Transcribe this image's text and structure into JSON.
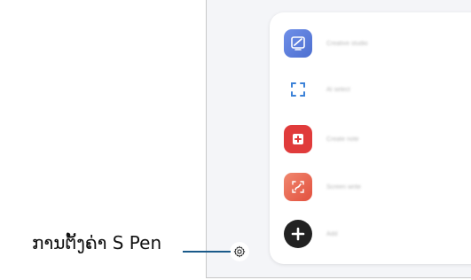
{
  "callout": {
    "label": "ການຕັ້ງຄ່າ S Pen",
    "line_color": "#1a5a8a"
  },
  "air_command": {
    "items": [
      {
        "icon": "creative-studio-icon",
        "label": "Creative studio",
        "color": "#5b7fd6"
      },
      {
        "icon": "ai-select-icon",
        "label": "AI select",
        "color": "#4a90d9"
      },
      {
        "icon": "create-note-icon",
        "label": "Create note",
        "color": "#e14444"
      },
      {
        "icon": "screen-write-icon",
        "label": "Screen write",
        "color": "#ef6a54"
      },
      {
        "icon": "add-icon",
        "label": "Add",
        "color": "#222222"
      }
    ]
  },
  "settings": {
    "icon": "gear-icon"
  }
}
